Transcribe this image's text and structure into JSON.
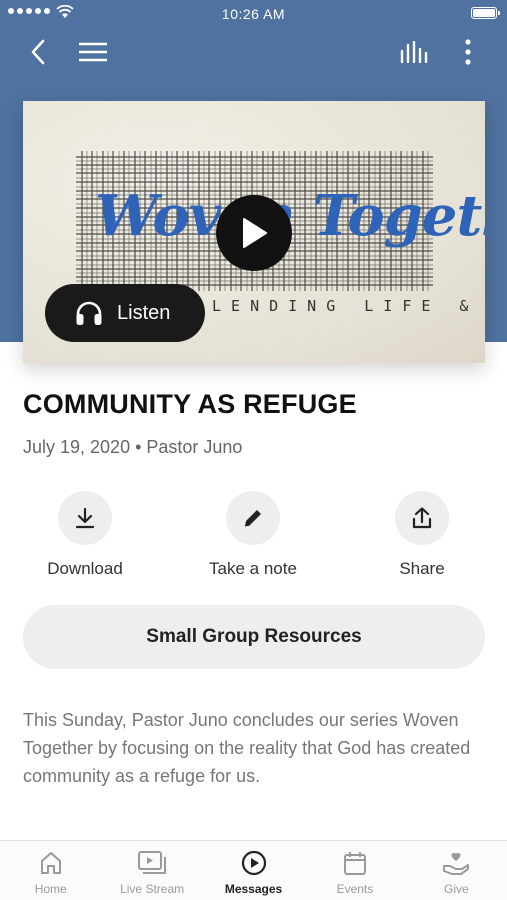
{
  "status_bar": {
    "time": "10:26 AM"
  },
  "nav": {
    "back_icon": "chevron-left-icon",
    "menu_icon": "hamburger-icon",
    "stats_icon": "bar-chart-icon",
    "more_icon": "vertical-dots-icon"
  },
  "hero": {
    "artwork_title": "Woven Together",
    "artwork_subtitle": "BLENDING LIFE & FAITH",
    "play_icon": "play-icon",
    "listen_label": "Listen",
    "listen_icon": "headphones-icon"
  },
  "sermon": {
    "title": "COMMUNITY AS REFUGE",
    "meta": "July 19, 2020 • Pastor Juno",
    "description": "This Sunday, Pastor Juno concludes our series Woven Together by focusing on the reality that God has created community as a refuge for us."
  },
  "actions": [
    {
      "label": "Download",
      "icon": "download-icon"
    },
    {
      "label": "Take a note",
      "icon": "pencil-icon"
    },
    {
      "label": "Share",
      "icon": "share-icon"
    }
  ],
  "resources_button": {
    "label": "Small Group Resources"
  },
  "tabs": [
    {
      "label": "Home",
      "icon": "home-icon",
      "active": false
    },
    {
      "label": "Live Stream",
      "icon": "live-stream-icon",
      "active": false
    },
    {
      "label": "Messages",
      "icon": "play-circle-icon",
      "active": true
    },
    {
      "label": "Events",
      "icon": "calendar-icon",
      "active": false
    },
    {
      "label": "Give",
      "icon": "give-hand-heart-icon",
      "active": false
    }
  ],
  "colors": {
    "header_blue": "#4f72a0",
    "artwork_blue": "#2f63b8",
    "active_tab": "#222222",
    "inactive_tab": "#9a9a9a"
  }
}
